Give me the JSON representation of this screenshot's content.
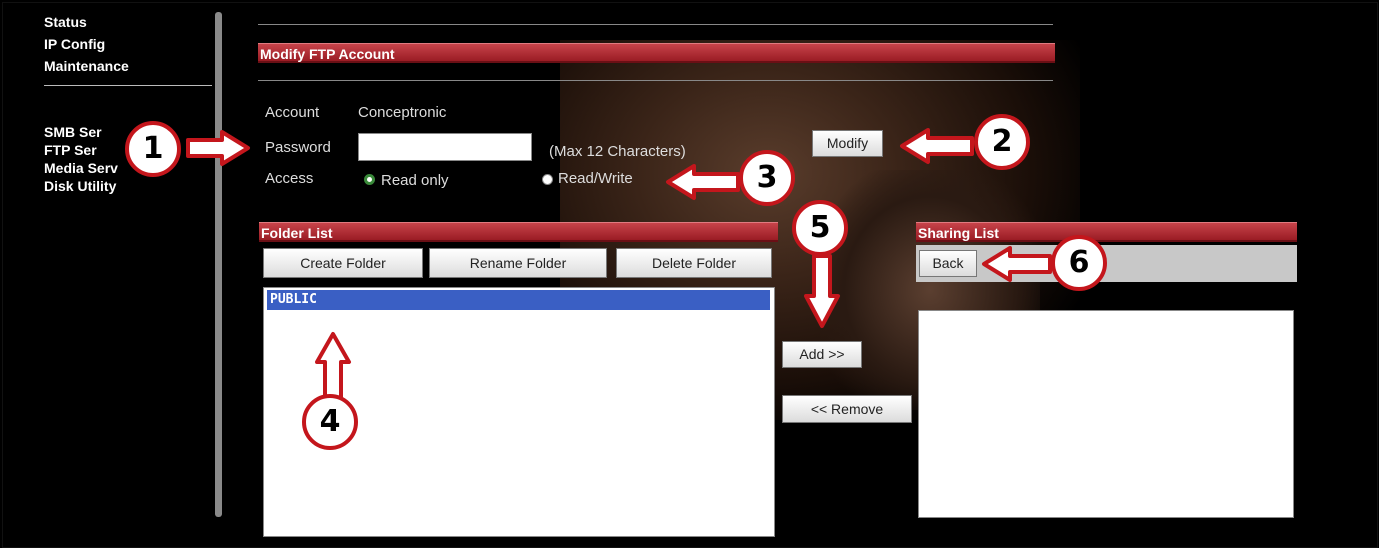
{
  "sidebar": {
    "items": [
      {
        "label": "Status"
      },
      {
        "label": "IP Config"
      },
      {
        "label": "Maintenance"
      },
      {
        "label": "SMB Ser"
      },
      {
        "label": "FTP Ser"
      },
      {
        "label": "Media Serv"
      },
      {
        "label": "Disk Utility"
      }
    ]
  },
  "header": {
    "title": "Modify FTP Account"
  },
  "form": {
    "account_label": "Account",
    "account_value": "Conceptronic",
    "password_label": "Password",
    "password_value": "",
    "password_hint": "(Max 12 Characters)",
    "access_label": "Access",
    "access_options": [
      {
        "label": "Read only",
        "selected": true
      },
      {
        "label": "Read/Write",
        "selected": false
      }
    ],
    "modify_button": "Modify"
  },
  "folder_list": {
    "title": "Folder List",
    "buttons": {
      "create": "Create Folder",
      "rename": "Rename Folder",
      "delete": "Delete Folder"
    },
    "items": [
      {
        "label": "PUBLIC",
        "selected": true
      }
    ]
  },
  "transfer": {
    "add": "Add >>",
    "remove": "<< Remove"
  },
  "sharing_list": {
    "title": "Sharing List",
    "back_button": "Back",
    "items": []
  },
  "callouts": [
    "1",
    "2",
    "3",
    "4",
    "5",
    "6"
  ],
  "colors": {
    "accent_red": "#b3262d",
    "callout_red": "#c4161c",
    "selection_blue": "#3a5fc4"
  }
}
